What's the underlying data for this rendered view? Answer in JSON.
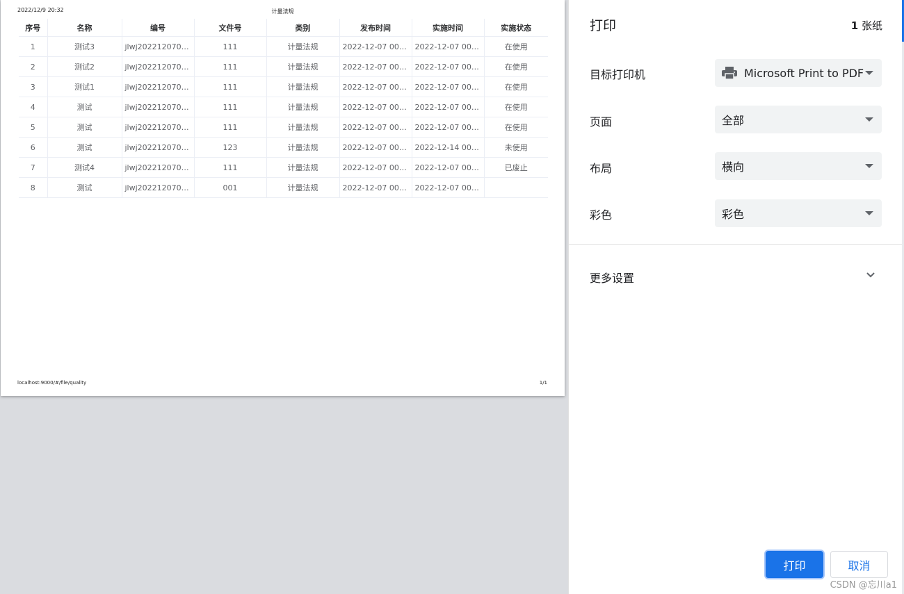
{
  "preview": {
    "header_date": "2022/12/9 20:32",
    "header_title": "计量法规",
    "footer_url": "localhost:9000/#/file/quality",
    "footer_page": "1/1",
    "table": {
      "columns": [
        "序号",
        "名称",
        "编号",
        "文件号",
        "类别",
        "发布时间",
        "实施时间",
        "实施状态"
      ],
      "rows": [
        [
          "1",
          "测试3",
          "jlwj2022120700...",
          "111",
          "计量法规",
          "2022-12-07 00:...",
          "2022-12-07 00:...",
          "在使用"
        ],
        [
          "2",
          "测试2",
          "jlwj2022120700...",
          "111",
          "计量法规",
          "2022-12-07 00:...",
          "2022-12-07 00:...",
          "在使用"
        ],
        [
          "3",
          "测试1",
          "jlwj2022120700...",
          "111",
          "计量法规",
          "2022-12-07 00:...",
          "2022-12-07 00:...",
          "在使用"
        ],
        [
          "4",
          "测试",
          "jlwj2022120700...",
          "111",
          "计量法规",
          "2022-12-07 00:...",
          "2022-12-07 00:...",
          "在使用"
        ],
        [
          "5",
          "测试",
          "jlwj2022120700...",
          "111",
          "计量法规",
          "2022-12-07 00:...",
          "2022-12-07 00:...",
          "在使用"
        ],
        [
          "6",
          "测试",
          "jlwj2022120700...",
          "123",
          "计量法规",
          "2022-12-07 00:...",
          "2022-12-14 00:...",
          "未使用"
        ],
        [
          "7",
          "测试4",
          "jlwj2022120700...",
          "111",
          "计量法规",
          "2022-12-07 00:...",
          "2022-12-07 00:...",
          "已废止"
        ],
        [
          "8",
          "测试",
          "jlwj2022120700...",
          "001",
          "计量法规",
          "2022-12-07 00:...",
          "2022-12-07 00:...",
          ""
        ]
      ]
    }
  },
  "panel": {
    "title": "打印",
    "sheet_count": "1",
    "sheet_unit": "张纸",
    "destination_label": "目标打印机",
    "destination_value": "Microsoft Print to PDF",
    "pages_label": "页面",
    "pages_value": "全部",
    "layout_label": "布局",
    "layout_value": "横向",
    "color_label": "彩色",
    "color_value": "彩色",
    "more_settings": "更多设置",
    "print_button": "打印",
    "cancel_button": "取消"
  },
  "watermark": "CSDN @忘川a1",
  "colors": {
    "accent": "#1a73e8",
    "select_bg": "#f1f3f4",
    "preview_bg": "#dadce0"
  }
}
